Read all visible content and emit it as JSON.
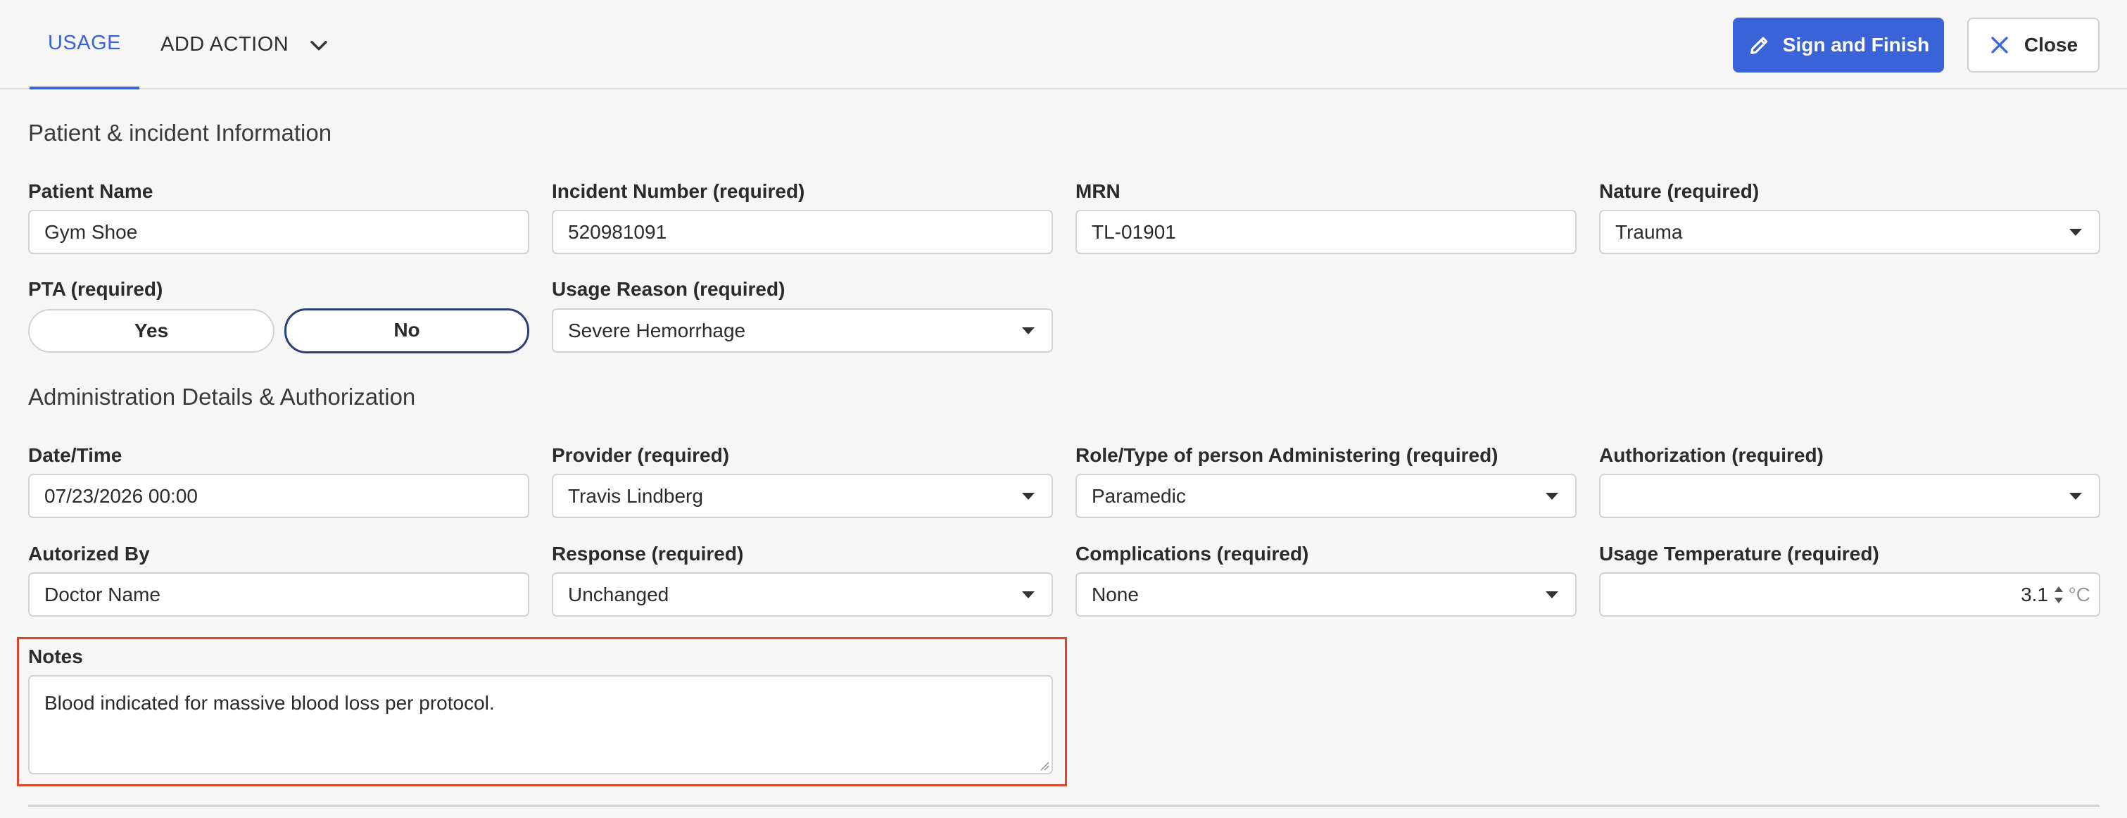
{
  "header": {
    "tab_usage": "USAGE",
    "add_action": "ADD ACTION",
    "sign_button": "Sign and Finish",
    "close_button": "Close"
  },
  "patient_section": {
    "title": "Patient & incident Information",
    "patient_name": {
      "label": "Patient Name",
      "value": "Gym Shoe"
    },
    "incident_number": {
      "label": "Incident Number (required)",
      "value": "520981091"
    },
    "mrn": {
      "label": "MRN",
      "value": "TL-01901"
    },
    "nature": {
      "label": "Nature (required)",
      "value": "Trauma"
    },
    "pta": {
      "label": "PTA (required)",
      "yes": "Yes",
      "no": "No",
      "selected": "No"
    },
    "usage_reason": {
      "label": "Usage Reason (required)",
      "value": "Severe Hemorrhage"
    }
  },
  "admin_section": {
    "title": "Administration Details & Authorization",
    "date_time": {
      "label": "Date/Time",
      "value": "07/23/2026 00:00"
    },
    "provider": {
      "label": "Provider (required)",
      "value": "Travis Lindberg"
    },
    "role": {
      "label": "Role/Type of person Administering (required)",
      "value": "Paramedic"
    },
    "authorization": {
      "label": "Authorization (required)",
      "value": ""
    },
    "authorized_by": {
      "label": "Autorized By",
      "value": "Doctor Name"
    },
    "response": {
      "label": "Response (required)",
      "value": "Unchanged"
    },
    "complications": {
      "label": "Complications (required)",
      "value": "None"
    },
    "usage_temperature": {
      "label": "Usage Temperature (required)",
      "value": "3.1",
      "unit": "°C"
    },
    "notes": {
      "label": "Notes",
      "value": "Blood indicated for massive blood loss per protocol."
    }
  },
  "colors": {
    "accent": "#3a63d8",
    "highlight": "#e0442b",
    "toggle_active_border": "#2c3f78",
    "background": "#f6f6f6"
  },
  "icons": {
    "add_action": "chevron-down-icon",
    "sign": "pen-icon",
    "close": "close-icon"
  }
}
